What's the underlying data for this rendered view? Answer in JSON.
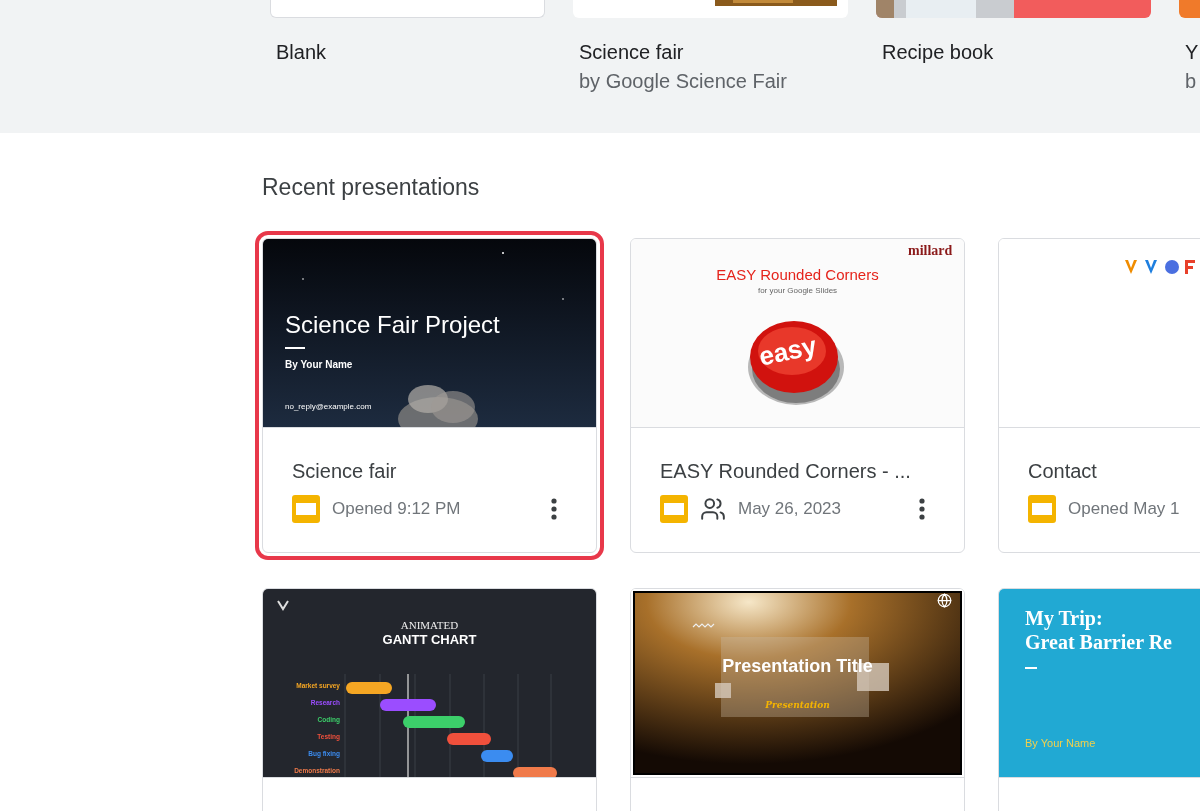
{
  "templates": [
    {
      "title": "Blank",
      "kind": "blank"
    },
    {
      "title": "Science fair",
      "subtitle": "by Google Science Fair",
      "kind": "strip"
    },
    {
      "title": "Recipe book"
    },
    {
      "title": "Y",
      "subtitle": "b",
      "kind": "orange"
    }
  ],
  "recent": {
    "heading": "Recent presentations",
    "files": [
      {
        "selected": true,
        "slide": {
          "kind": "night",
          "title": "Science Fair Project",
          "author": "By Your Name",
          "email": "no_reply@example.com"
        },
        "title": "Science fair",
        "shared": false,
        "opened": "Opened 9:12 PM",
        "menu": true
      },
      {
        "selected": false,
        "slide": {
          "kind": "easy",
          "title": "EASY Rounded Corners",
          "subtitle": "for your Google Slides",
          "button": "easy",
          "logo": "millard"
        },
        "title": "EASY Rounded Corners - ...",
        "shared": true,
        "opened": "May 26, 2023",
        "menu": true
      },
      {
        "selected": false,
        "slide": {
          "kind": "logos"
        },
        "title": "Contact",
        "shared": false,
        "opened": "Opened May 1"
      },
      {
        "selected": false,
        "slide": {
          "kind": "gantt",
          "overline": "ANIMATED",
          "title": "GANTT CHART",
          "tasks": [
            {
              "label": "Market survey",
              "color": "#f5a623"
            },
            {
              "label": "Research",
              "color": "#9b4dff"
            },
            {
              "label": "Coding",
              "color": "#3ccf6a"
            },
            {
              "label": "Testing",
              "color": "#f0503c"
            },
            {
              "label": "Bug fixing",
              "color": "#3b8cf0"
            },
            {
              "label": "Demonstration",
              "color": "#f07a4a"
            }
          ]
        }
      },
      {
        "selected": false,
        "slide": {
          "kind": "spotlight",
          "title": "Presentation Title",
          "script": "Presentation"
        }
      },
      {
        "selected": false,
        "slide": {
          "kind": "trip",
          "title": "My Trip:",
          "subtitle": "Great Barrier Re",
          "author": "By Your Name"
        }
      }
    ]
  }
}
